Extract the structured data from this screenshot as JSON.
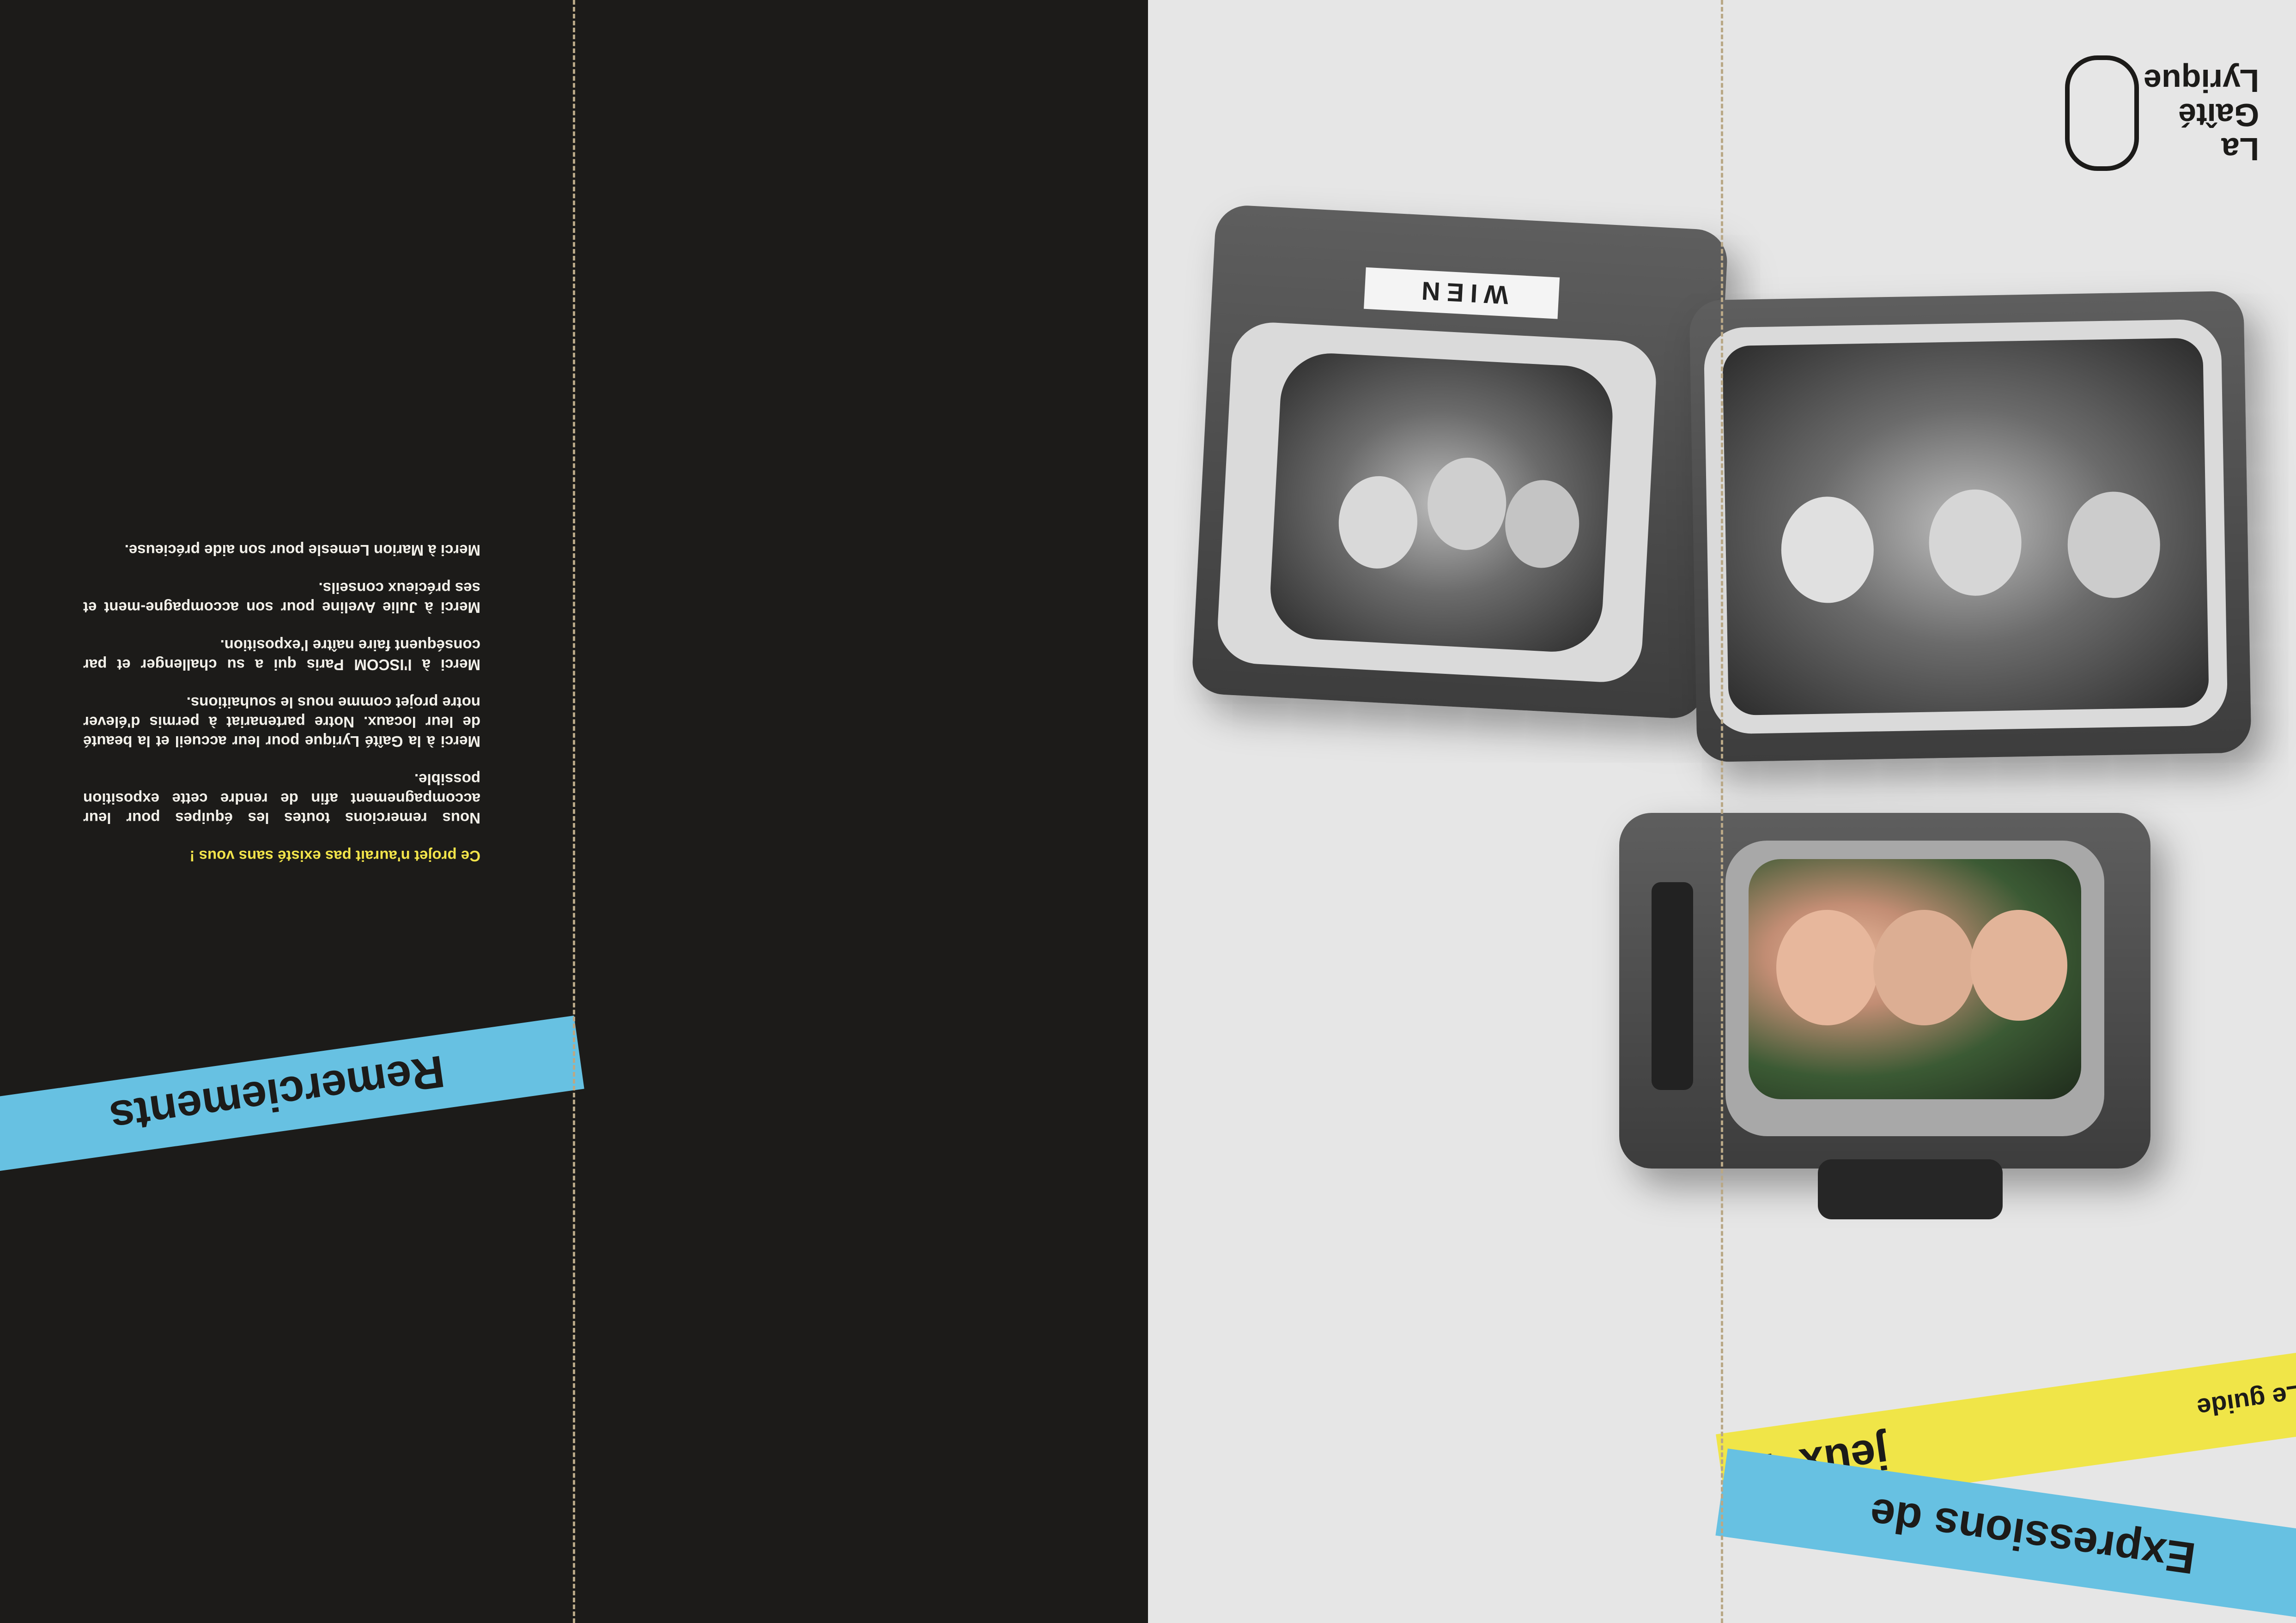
{
  "thanks": {
    "lead": "Ce projet n'aurait pas existé sans vous !",
    "paragraphs": [
      "Nous remercions toutes les équipes pour leur accompagnement afin de rendre cette exposition possible.",
      "Merci à la Gaîté Lyrique pour leur accueil et la beauté de leur locaux. Notre partenariat à permis d'élever notre projet comme nous le souhaitions.",
      "Merci à l'ISCOM Paris qui a su challenger et par conséquent faire naître l'exposition.",
      "Merci à Julie Aveline pour son accompagne-ment et ses précieux conseils.",
      "Merci à Marion Lemesle pour son aide précieuse."
    ],
    "banner": "Remerciements"
  },
  "cover": {
    "logo_lines": [
      "La",
      "Gaîté",
      "Lyrique"
    ],
    "tv_label": "WIEN",
    "guide_sub": "Le guide",
    "guide_title_line1": "Expressions de",
    "guide_title_line2": "jeux' !"
  },
  "colors": {
    "dark_panel": "#1c1b19",
    "light_panel": "#e6e6e6",
    "blue": "#67c1e2",
    "yellow": "#f0e548",
    "fold_line": "#b9a887"
  }
}
